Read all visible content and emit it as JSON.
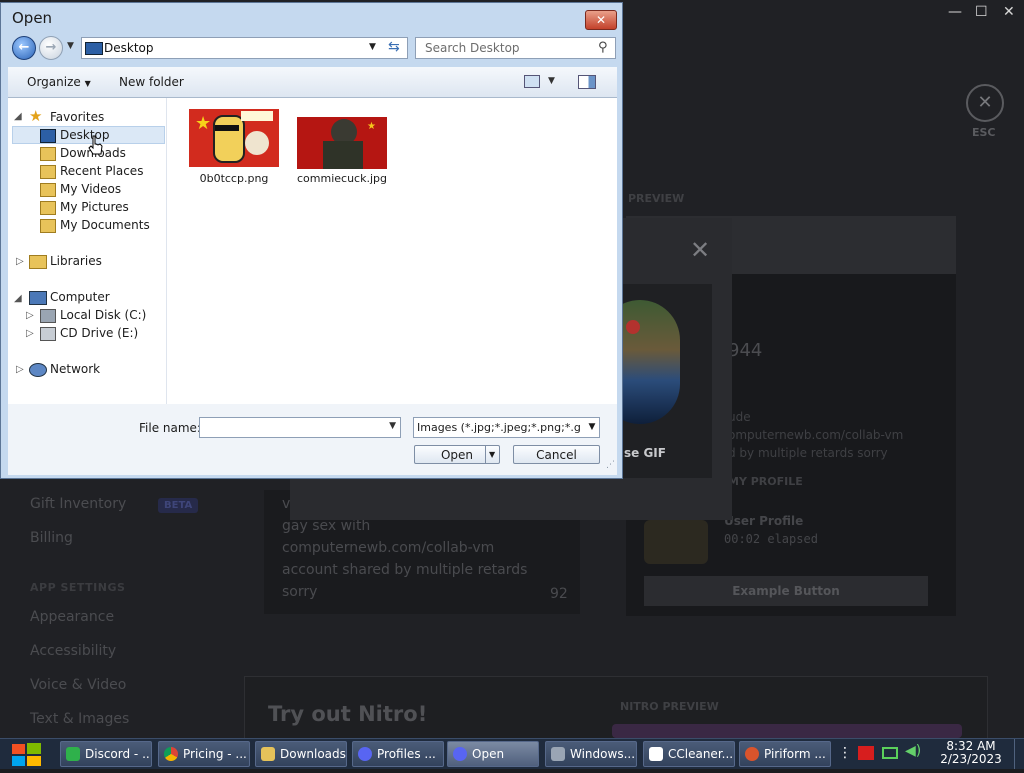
{
  "discord": {
    "window_controls": [
      "—",
      "☐",
      "✕"
    ],
    "esc_label": "ESC",
    "preview_label": "PREVIEW",
    "sidebar": {
      "gift_inventory": "Gift Inventory",
      "beta_badge": "BETA",
      "billing": "Billing",
      "app_settings_header": "APP SETTINGS",
      "appearance": "Appearance",
      "accessibility": "Accessibility",
      "voice_video": "Voice & Video",
      "text_images": "Text & Images"
    },
    "bio_lines": [
      "v",
      "gay sex with",
      "computernewb.com/collab-vm",
      "account shared by multiple retards",
      "sorry"
    ],
    "bio_count": "92",
    "profile_preview": {
      "discriminator": "944",
      "line1": "ude",
      "line2": "omputernewb.com/collab-vm",
      "line3": "d by multiple retards sorry",
      "my_profile": "MY PROFILE",
      "activity_title": "User Profile",
      "activity_elapsed": "00:02 elapsed",
      "example_button": "Example Button"
    },
    "modal_gif_text": "se GIF",
    "nitro": {
      "title": "Try out Nitro!",
      "preview": "NITRO PREVIEW"
    }
  },
  "dialog": {
    "title": "Open",
    "address": "Desktop",
    "search_placeholder": "Search Desktop",
    "toolbar": {
      "organize": "Organize",
      "new_folder": "New folder"
    },
    "nav": {
      "favorites": "Favorites",
      "desktop": "Desktop",
      "downloads": "Downloads",
      "recent_places": "Recent Places",
      "my_videos": "My Videos",
      "my_pictures": "My Pictures",
      "my_documents": "My Documents",
      "libraries": "Libraries",
      "computer": "Computer",
      "local_disk": "Local Disk (C:)",
      "cd_drive": "CD Drive (E:)",
      "network": "Network"
    },
    "files": [
      {
        "name": "0b0tccp.png"
      },
      {
        "name": "commiecuck.jpg"
      }
    ],
    "file_name_label": "File name:",
    "file_name_value": "",
    "file_type": "Images (*.jpg;*.jpeg;*.png;*.g",
    "open_button": "Open",
    "cancel_button": "Cancel"
  },
  "taskbar": {
    "buttons": [
      {
        "label": "Discord - ...",
        "icon_color": "#2fb14b"
      },
      {
        "label": "Pricing - ...",
        "icon_color": "#e0a020"
      },
      {
        "label": "Downloads",
        "icon_color": "#e5c25a"
      },
      {
        "label": "Profiles ...",
        "icon_color": "#5865f2"
      },
      {
        "label": "Open",
        "icon_color": "#5865f2"
      },
      {
        "label": "Windows...",
        "icon_color": "#9aa5b4"
      },
      {
        "label": "CCleaner...",
        "icon_color": "#ffffff"
      },
      {
        "label": "Piriform ...",
        "icon_color": "#d9542c"
      }
    ],
    "time": "8:32 AM",
    "date": "2/23/2023"
  }
}
